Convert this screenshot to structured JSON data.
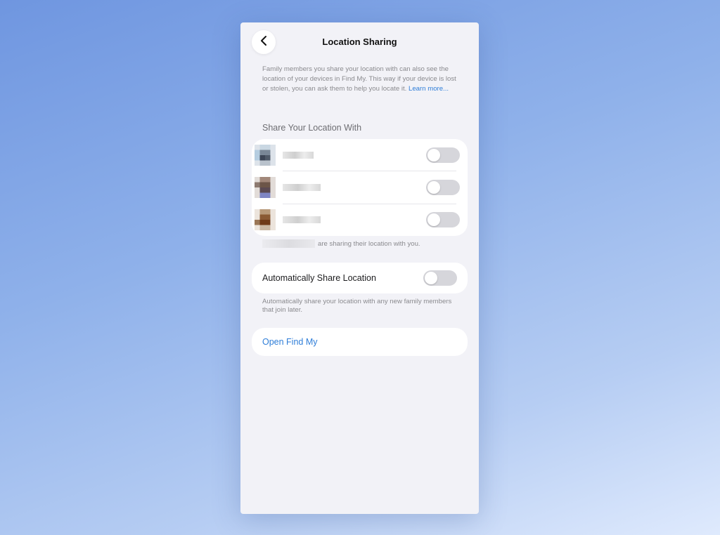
{
  "page": {
    "title": "Location Sharing",
    "back_icon": "chevron-left-icon"
  },
  "intro": {
    "text": "Family members you share your location with can also see the location of your devices in Find My. This way if your device is lost or stolen, you can ask them to help you locate it.",
    "link": "Learn more..."
  },
  "share_section": {
    "header": "Share Your Location With",
    "members": [
      {
        "name": "",
        "sharing": false
      },
      {
        "name": "",
        "sharing": false
      },
      {
        "name": "",
        "sharing": false
      }
    ],
    "sharing_note": "are sharing their location with you."
  },
  "auto_share": {
    "label": "Automatically Share Location",
    "enabled": false,
    "help": "Automatically share your location with any new family members that join later."
  },
  "find_my": {
    "label": "Open Find My"
  },
  "colors": {
    "accent": "#2f7ed8",
    "toggle_off": "#d6d6db",
    "sheet_bg": "#f2f2f7"
  }
}
